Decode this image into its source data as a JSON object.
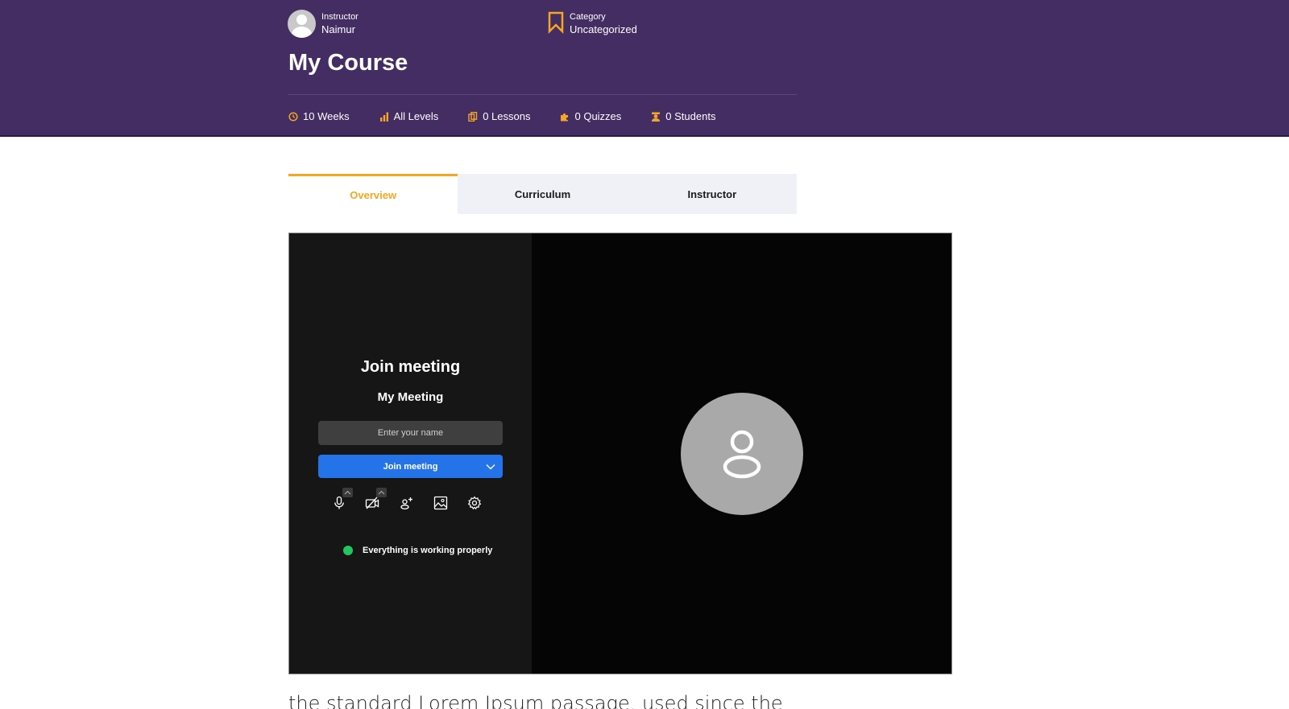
{
  "header": {
    "instructor_label": "Instructor",
    "instructor_name": "Naimur",
    "category_label": "Category",
    "category_value": "Uncategorized",
    "course_title": "My Course",
    "stats": [
      {
        "icon": "clock-icon",
        "label": "10 Weeks"
      },
      {
        "icon": "bar-chart-icon",
        "label": "All Levels"
      },
      {
        "icon": "copy-icon",
        "label": "0 Lessons"
      },
      {
        "icon": "puzzle-icon",
        "label": "0 Quizzes"
      },
      {
        "icon": "student-icon",
        "label": "0 Students"
      }
    ]
  },
  "tabs": [
    {
      "label": "Overview",
      "active": true
    },
    {
      "label": "Curriculum",
      "active": false
    },
    {
      "label": "Instructor",
      "active": false
    }
  ],
  "meeting": {
    "title": "Join meeting",
    "meeting_name": "My Meeting",
    "name_placeholder": "Enter your name",
    "name_value": "",
    "join_button": "Join meeting",
    "controls": [
      "microphone-icon",
      "camera-off-icon",
      "invite-user-icon",
      "background-image-icon",
      "settings-gear-icon"
    ],
    "status_text": "Everything is working properly",
    "status_color": "#22c55e"
  },
  "content": {
    "text": "the standard Lorem Ipsum passage, used since the"
  },
  "colors": {
    "hero_bg": "#432d63",
    "accent": "#f5a623",
    "join_button": "#2573e8"
  }
}
